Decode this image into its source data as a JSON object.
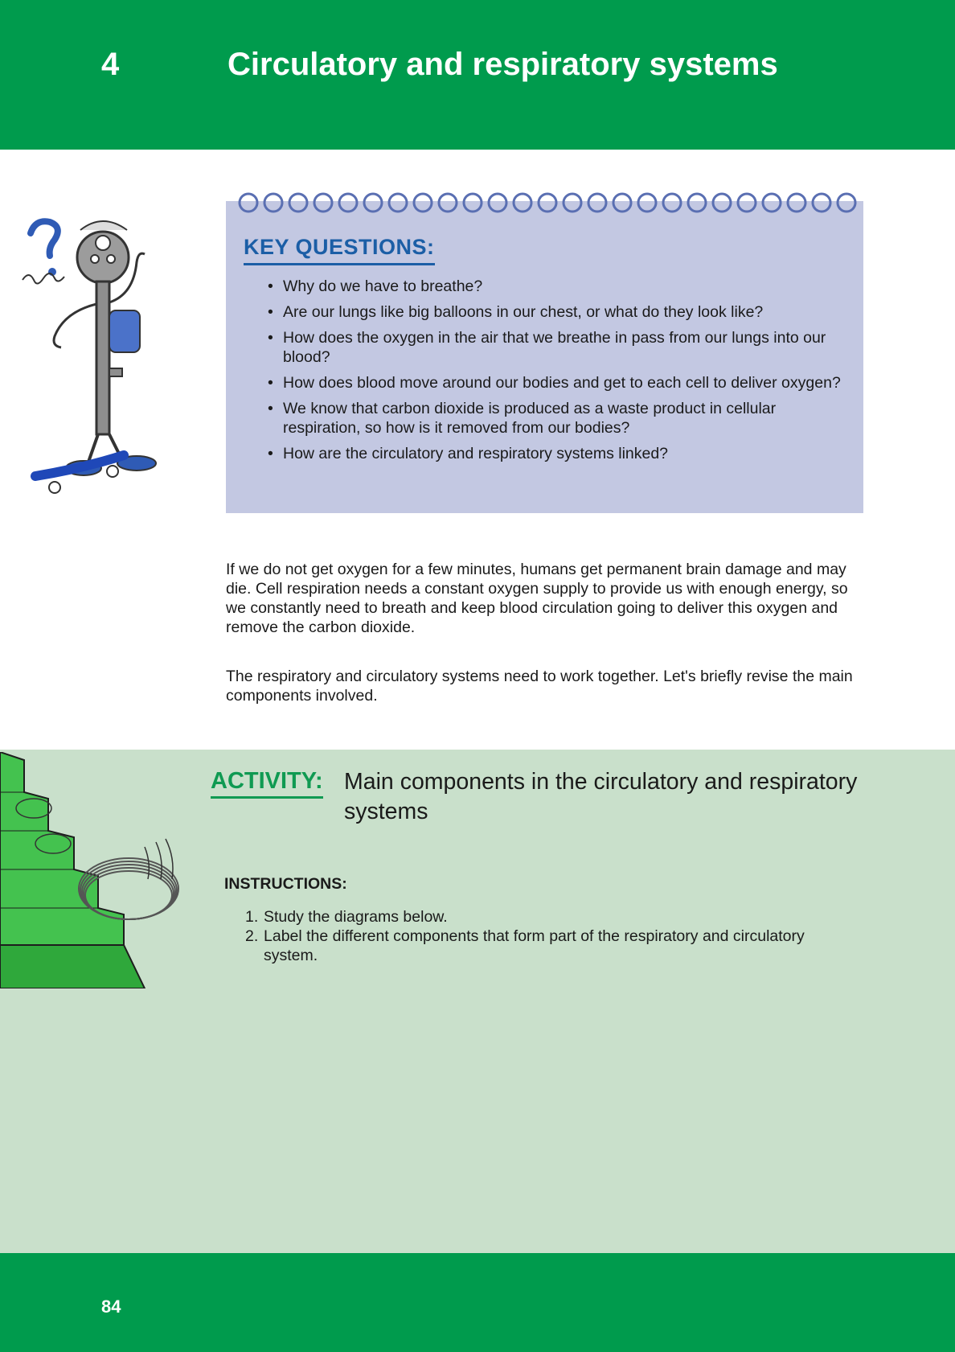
{
  "header": {
    "chapter_number": "4",
    "chapter_title": "Circulatory and respiratory systems"
  },
  "key_questions": {
    "title": "KEY QUESTIONS:",
    "items": [
      "Why do we have to breathe?",
      "Are our lungs like big balloons in our chest, or what do they look like?",
      "How does the oxygen in the air that we breathe in pass from our lungs into our blood?",
      "How does blood move around our bodies and get to each cell to deliver oxygen?",
      "We know that carbon dioxide is produced as a waste product in cellular respiration, so how is it removed from our bodies?",
      "How are the circulatory and respiratory systems linked?"
    ]
  },
  "body": {
    "paragraph_1": "If we do not get oxygen for a few minutes, humans get permanent brain damage and may die. Cell respiration needs a constant oxygen supply to provide us with enough energy, so we constantly need to breath and keep blood circulation going to deliver this oxygen and remove the carbon dioxide.",
    "paragraph_2": "The respiratory and circulatory systems need to work together. Let's briefly revise the main components involved."
  },
  "activity": {
    "label": "ACTIVITY:",
    "title": "Main components in the circulatory and respiratory systems",
    "instructions_heading": "INSTRUCTIONS:",
    "instructions": [
      {
        "num": "1.",
        "text": "Study the diagrams below."
      },
      {
        "num": "2.",
        "text": "Label the different components that form part of the respiratory and circulatory system."
      }
    ]
  },
  "footer": {
    "page_number": "84"
  },
  "colors": {
    "brand_green": "#009b4d",
    "notepad_blue": "#c3c8e2",
    "heading_blue": "#1b5ea6",
    "activity_bg": "#c9e0cb",
    "activity_green": "#0f9a52"
  },
  "illustrations": {
    "key_character": "key-character-on-skateboard-icon",
    "stairs_spring": "spring-on-stairs-icon"
  }
}
